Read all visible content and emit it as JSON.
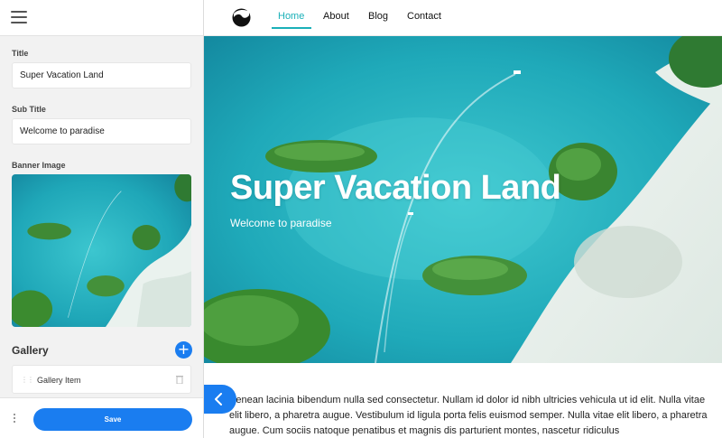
{
  "editor": {
    "title_label": "Title",
    "title_value": "Super Vacation Land",
    "subtitle_label": "Sub Title",
    "subtitle_value": "Welcome to paradise",
    "banner_label": "Banner Image",
    "gallery_label": "Gallery",
    "add_icon": "+",
    "gallery_items": [
      {
        "label": "Gallery Item"
      }
    ],
    "save_label": "Save"
  },
  "site": {
    "nav": [
      {
        "label": "Home",
        "active": true
      },
      {
        "label": "About"
      },
      {
        "label": "Blog"
      },
      {
        "label": "Contact"
      }
    ],
    "hero_title": "Super Vacation Land",
    "hero_subtitle": "Welcome to paradise",
    "body_text": "Aenean lacinia bibendum nulla sed consectetur. Nullam id dolor id nibh ultricies vehicula ut id elit. Nulla vitae elit libero, a pharetra augue. Vestibulum id ligula porta felis euismod semper. Nulla vitae elit libero, a pharetra augue. Cum sociis natoque penatibus et magnis dis parturient montes, nascetur ridiculus"
  },
  "colors": {
    "accent": "#1a7df0",
    "nav_active": "#1ab0b8",
    "water": "#27b2c0",
    "sand": "#e9f0ec",
    "island": "#3f8a35"
  },
  "icons": [
    "menu-icon",
    "logo-icon",
    "plus-icon",
    "drag-handle-icon",
    "trash-icon",
    "more-vertical-icon",
    "chevron-left-icon"
  ]
}
